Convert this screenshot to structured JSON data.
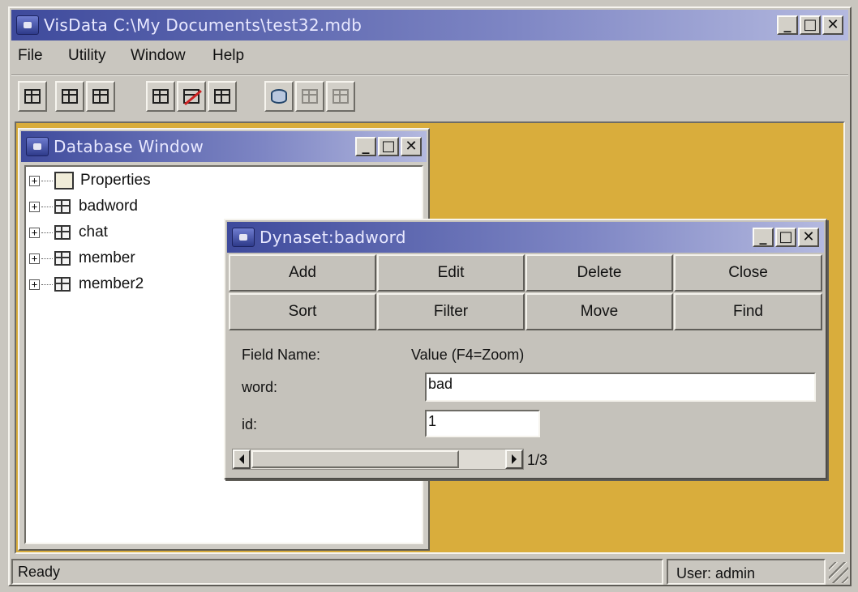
{
  "app": {
    "title": "VisData C:\\My Documents\\test32.mdb",
    "colors": {
      "titlebar_start": "#3e4a9c",
      "titlebar_end": "#b4b9df",
      "mdi_background": "#d9ad3c"
    }
  },
  "window_buttons": {
    "minimize": "_",
    "maximize": "□",
    "close": "✕"
  },
  "menu": {
    "items": [
      "File",
      "Utility",
      "Window",
      "Help"
    ]
  },
  "toolbar": {
    "buttons": [
      {
        "icon": "table-type-icon",
        "enabled": true
      },
      {
        "icon": "dynaset-type-icon",
        "enabled": true
      },
      {
        "icon": "snapshot-type-icon",
        "enabled": true
      },
      {
        "icon": "use-data-control-icon",
        "enabled": true
      },
      {
        "icon": "no-data-control-icon",
        "enabled": true
      },
      {
        "icon": "dbgrid-icon",
        "enabled": true
      },
      {
        "icon": "begin-transaction-icon",
        "enabled": true
      },
      {
        "icon": "commit-icon",
        "enabled": false
      },
      {
        "icon": "rollback-icon",
        "enabled": false
      }
    ]
  },
  "database_window": {
    "title": "Database Window",
    "items": [
      {
        "label": "Properties",
        "icon": "properties-icon"
      },
      {
        "label": "badword",
        "icon": "table-icon"
      },
      {
        "label": "chat",
        "icon": "table-icon"
      },
      {
        "label": "member",
        "icon": "table-icon"
      },
      {
        "label": "member2",
        "icon": "table-icon"
      }
    ]
  },
  "dynaset_window": {
    "title": "Dynaset:badword",
    "buttons": {
      "add": "Add",
      "edit": "Edit",
      "delete": "Delete",
      "close": "Close",
      "sort": "Sort",
      "filter": "Filter",
      "move": "Move",
      "find": "Find"
    },
    "header": {
      "field_name": "Field Name:",
      "value": "Value (F4=Zoom)"
    },
    "fields": [
      {
        "name": "word:",
        "value": "bad"
      },
      {
        "name": "id:",
        "value": "1"
      }
    ],
    "record_position": "1/3"
  },
  "status_bar": {
    "status": "Ready",
    "user": "User: admin"
  }
}
